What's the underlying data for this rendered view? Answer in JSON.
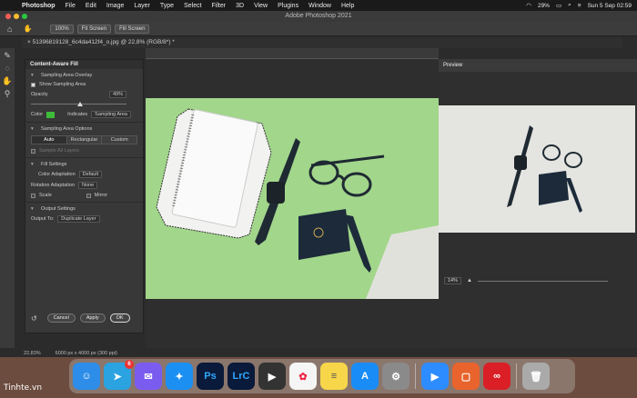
{
  "menubar": {
    "app": "Photoshop",
    "items": [
      "File",
      "Edit",
      "Image",
      "Layer",
      "Type",
      "Select",
      "Filter",
      "3D",
      "View",
      "Plugins",
      "Window",
      "Help"
    ],
    "battery": "29%",
    "datetime": "Sun 5 Sep  02:59"
  },
  "window": {
    "title": "Adobe Photoshop 2021"
  },
  "options": {
    "zoom_100": "100%",
    "fit_screen": "Fit Screen",
    "fill_screen": "Fill Screen"
  },
  "document": {
    "tab": "51396819128_6c4da412f4_o.jpg @ 22,8% (RGB/8*) *"
  },
  "caf": {
    "title": "Content-Aware Fill",
    "sampling_overlay": {
      "heading": "Sampling Area Overlay",
      "show_label": "Show Sampling Area",
      "opacity_label": "Opacity",
      "opacity_value": "49%",
      "opacity_fraction": 0.49,
      "color_label": "Color",
      "color_value": "#3dbb3a",
      "indicates_label": "Indicates",
      "indicates_value": "Sampling Area"
    },
    "sampling_options": {
      "heading": "Sampling Area Options",
      "auto": "Auto",
      "rectangular": "Rectangular",
      "custom": "Custom",
      "all_layers": "Sample All Layers"
    },
    "fill": {
      "heading": "Fill Settings",
      "color_adapt_label": "Color Adaptation",
      "color_adapt_value": "Default",
      "rot_adapt_label": "Rotation Adaptation",
      "rot_adapt_value": "None",
      "scale": "Scale",
      "mirror": "Mirror"
    },
    "output": {
      "heading": "Output Settings",
      "output_label": "Output To:",
      "output_value": "Duplicate Layer"
    },
    "cancel": "Cancel",
    "apply": "Apply",
    "ok": "OK"
  },
  "preview": {
    "title": "Preview",
    "zoom": "14%"
  },
  "status": {
    "zoom": "22,83%",
    "dims": "6000 px x 4000 px (300 ppi)"
  },
  "watermark": "Tinhte.vn",
  "dock": {
    "telegram_badge": "6"
  }
}
